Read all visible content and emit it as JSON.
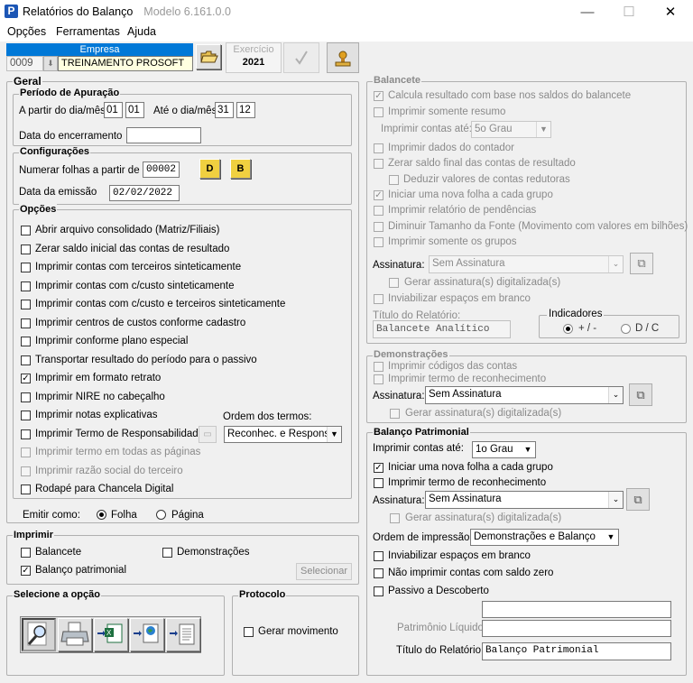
{
  "window": {
    "title": "Relatórios do Balanço",
    "title_extra": "Modelo 6.161.0.0",
    "min": "—",
    "max": "☐",
    "close": "✕"
  },
  "menu": [
    "Opções",
    "Ferramentas",
    "Ajuda"
  ],
  "empresa": {
    "header": "Empresa",
    "code": "0009",
    "name": "TREINAMENTO PROSOFT"
  },
  "exercicio": {
    "label": "Exercício",
    "value": "2021"
  },
  "geral": {
    "title": "Geral",
    "periodo": {
      "title": "Período de Apuração",
      "from_label": "A partir do dia/mês",
      "from_day": "01",
      "from_month": "01",
      "to_label": "Até o dia/mês",
      "to_day": "31",
      "to_month": "12",
      "encerramento_label": "Data do encerramento",
      "encerramento_value": ""
    },
    "config": {
      "title": "Configurações",
      "numerar_label": "Numerar folhas a partir de",
      "numerar_value": "00002",
      "btn_d": "D",
      "btn_b": "B",
      "emissao_label": "Data da emissão",
      "emissao_value": "02/02/2022"
    },
    "opcoes": {
      "title": "Opções",
      "items": [
        {
          "label": "Abrir arquivo consolidado (Matriz/Filiais)",
          "mark": ""
        },
        {
          "label": "Zerar saldo inicial das contas de resultado",
          "mark": ""
        },
        {
          "label": "Imprimir contas com terceiros sinteticamente",
          "mark": ""
        },
        {
          "label": "Imprimir contas com c/custo sinteticamente",
          "mark": ""
        },
        {
          "label": "Imprimir contas com c/custo e terceiros sinteticamente",
          "mark": ""
        },
        {
          "label": "Imprimir centros de custos conforme cadastro",
          "mark": ""
        },
        {
          "label": "Imprimir conforme plano especial",
          "mark": ""
        },
        {
          "label": "Transportar resultado do período para o passivo",
          "mark": ""
        },
        {
          "label": "Imprimir em formato retrato",
          "mark": "✓"
        },
        {
          "label": "Imprimir NIRE no cabeçalho",
          "mark": ""
        },
        {
          "label": "Imprimir notas explicativas",
          "mark": ""
        },
        {
          "label": "Imprimir Termo de Responsabilidade",
          "mark": ""
        },
        {
          "label": "Imprimir termo em todas as páginas",
          "mark": ""
        },
        {
          "label": "Imprimir razão social do terceiro",
          "mark": ""
        },
        {
          "label": "Rodapé para Chancela Digital",
          "mark": ""
        }
      ],
      "ordem_label": "Ordem dos termos:",
      "ordem_value": "Reconhec. e Respons."
    },
    "emitir": {
      "label": "Emitir como:",
      "folha": "Folha",
      "pagina": "Página"
    }
  },
  "imprimir": {
    "title": "Imprimir",
    "balancete": "Balancete",
    "demonstracoes": "Demonstrações",
    "balanco": "Balanço patrimonial",
    "balanco_mark": "✓",
    "selecionar": "Selecionar"
  },
  "selecione": {
    "title": "Selecione a opção"
  },
  "protocolo": {
    "title": "Protocolo",
    "gerar": "Gerar movimento"
  },
  "balancete": {
    "title": "Balancete",
    "items": [
      {
        "label": "Calcula resultado com base nos saldos do balancete",
        "mark": "✓"
      },
      {
        "label": "Imprimir somente resumo",
        "mark": ""
      }
    ],
    "contas_label": "Imprimir contas até:",
    "contas_value": "5o Grau",
    "items2": [
      {
        "label": "Imprimir dados do contador",
        "mark": ""
      },
      {
        "label": "Zerar saldo final das contas de resultado",
        "mark": ""
      },
      {
        "label": "Deduzir valores de contas redutoras",
        "mark": ""
      },
      {
        "label": "Iniciar uma nova folha a cada grupo",
        "mark": "✓"
      },
      {
        "label": "Imprimir relatório de pendências",
        "mark": ""
      },
      {
        "label": "Diminuir Tamanho da Fonte (Movimento com valores em bilhões)",
        "mark": ""
      },
      {
        "label": "Imprimir somente os grupos",
        "mark": ""
      }
    ],
    "assinatura_label": "Assinatura:",
    "assinatura_value": "Sem Assinatura",
    "gerar_assinatura": "Gerar assinatura(s) digitalizada(s)",
    "inviabilizar": "Inviabilizar espaços em branco",
    "titulo_label": "Título do Relatório:",
    "titulo_value": "Balancete Analítico",
    "indicadores": {
      "title": "Indicadores",
      "opt1": "+ / -",
      "opt2": "D / C"
    }
  },
  "demonstracoes": {
    "title": "Demonstrações",
    "codigos": "Imprimir códigos das contas",
    "termo": "Imprimir termo de reconhecimento",
    "assinatura_label": "Assinatura:",
    "assinatura_value": "Sem Assinatura",
    "gerar": "Gerar assinatura(s) digitalizada(s)"
  },
  "balanco": {
    "title": "Balanço Patrimonial",
    "contas_label": "Imprimir contas até:",
    "contas_value": "1o Grau",
    "nova_folha": "Iniciar uma nova folha a cada grupo",
    "nova_folha_mark": "✓",
    "termo": "Imprimir termo de reconhecimento",
    "assinatura_label": "Assinatura:",
    "assinatura_value": "Sem Assinatura",
    "gerar": "Gerar assinatura(s) digitalizada(s)",
    "ordem_label": "Ordem de impressão:",
    "ordem_value": "Demonstrações e Balanço",
    "inviabilizar": "Inviabilizar espaços em branco",
    "nao_imprimir": "Não imprimir contas com saldo zero",
    "passivo": "Passivo a Descoberto",
    "pl_label": "Patrimônio Líquido",
    "titulo_label": "Título do Relatório:",
    "titulo_value": "Balanço Patrimonial"
  }
}
